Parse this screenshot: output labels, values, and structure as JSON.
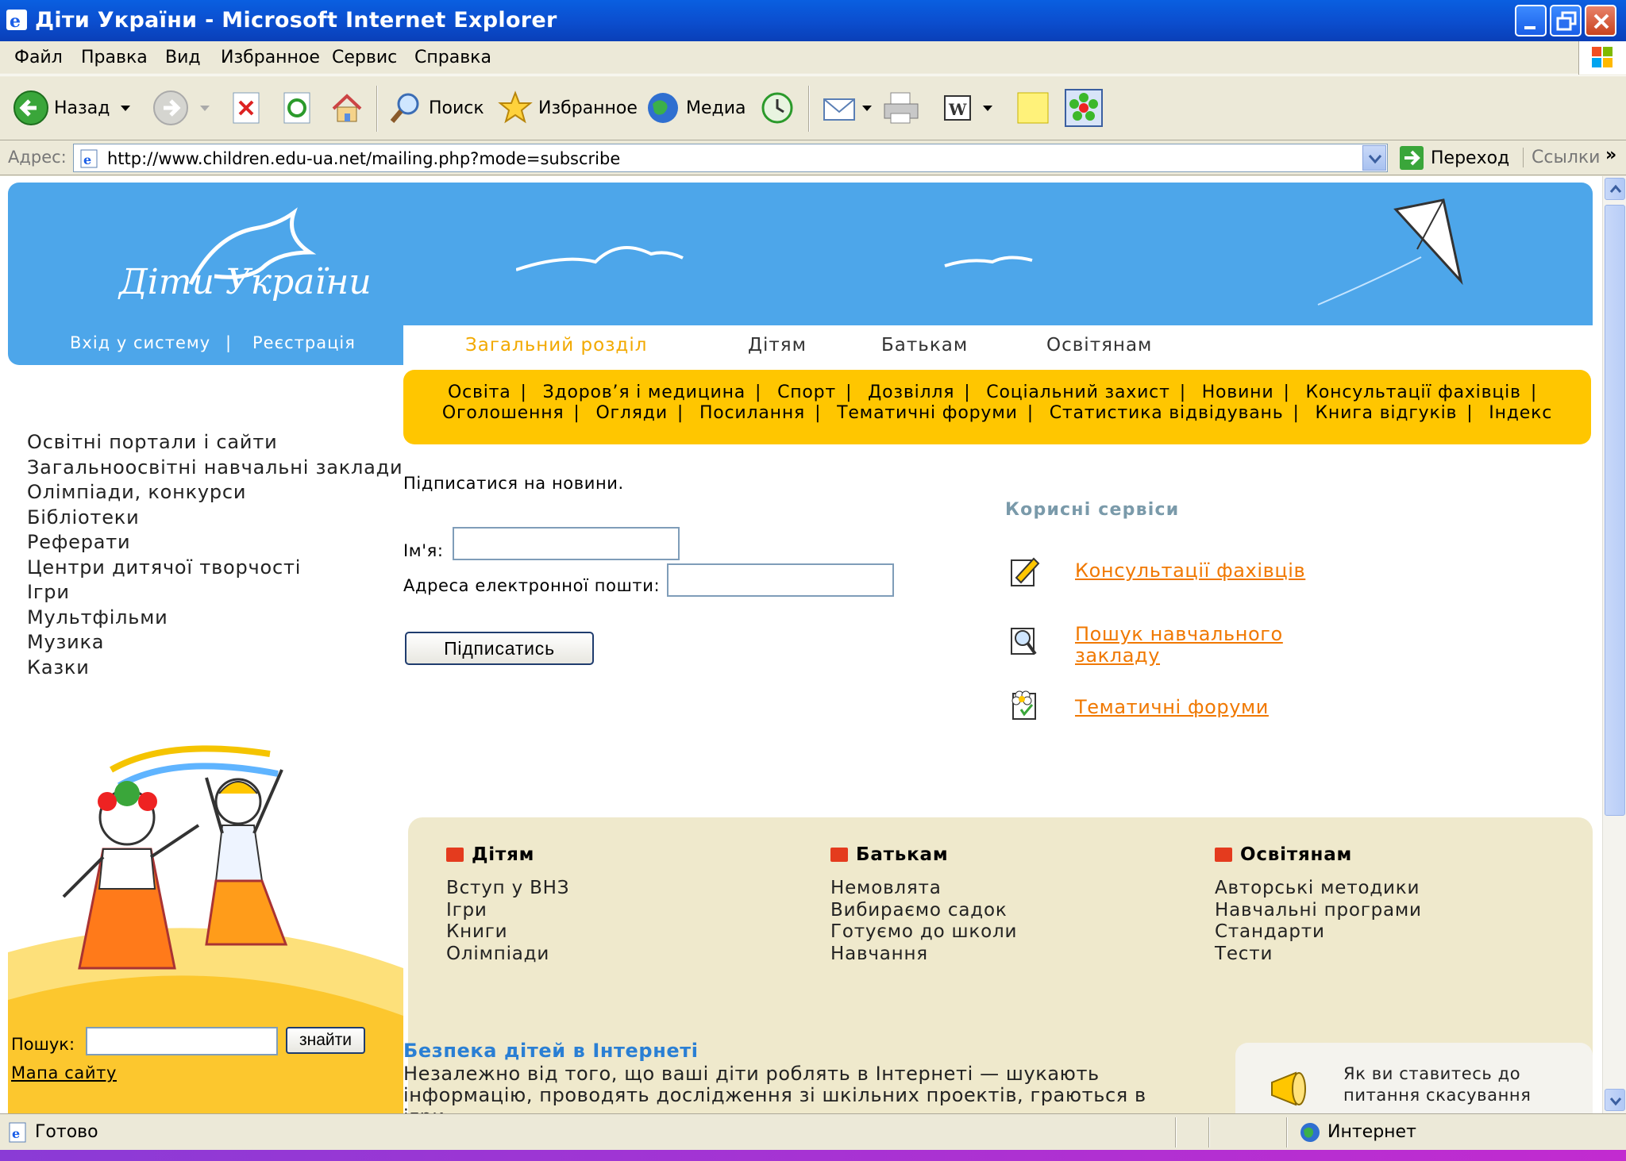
{
  "window": {
    "title": "Діти України - Microsoft Internet Explorer"
  },
  "menu": [
    "Файл",
    "Правка",
    "Вид",
    "Избранное",
    "Сервис",
    "Справка"
  ],
  "toolbar": {
    "back": "Назад",
    "search": "Поиск",
    "favorites": "Избранное",
    "media": "Медиа"
  },
  "address": {
    "label": "Адрес:",
    "url": "http://www.children.edu-ua.net/mailing.php?mode=subscribe",
    "go": "Переход",
    "links": "Ссылки"
  },
  "status": {
    "text": "Готово",
    "zone": "Интернет"
  },
  "site": {
    "logo": "Діти України",
    "login": "Вхід у систему",
    "login_sep": "|",
    "register": "Реєстрація",
    "tabs": [
      "Загальний розділ",
      "Дітям",
      "Батькам",
      "Освітянам"
    ],
    "nav_row1": [
      "Освіта",
      "Здоров’я і медицина",
      "Спорт",
      "Дозвілля",
      "Соціальний захист",
      "Новини",
      "Консультації фахівців"
    ],
    "nav_row2": [
      "Оголошення",
      "Огляди",
      "Посилання",
      "Тематичні форуми",
      "Статистика відвідувань",
      "Книга відгуків",
      "Індекс"
    ],
    "nav_sep": "|",
    "left_links": [
      "Освітні портали і сайти",
      "Загальноосвітні навчальні заклади",
      "Олімпіади, конкурси",
      "Бібліотеки",
      "Реферати",
      "Центри дитячої творчості",
      "Ігри",
      "Мультфільми",
      "Музика",
      "Казки"
    ],
    "search_label": "Пошук:",
    "search_button": "знайти",
    "sitemap": "Мапа сайту"
  },
  "subscribe": {
    "title": "Підписатися на новини.",
    "name_label": "Ім'я:",
    "email_label": "Адреса електронної пошти:",
    "button": "Підписатись"
  },
  "services": {
    "title": "Корисні сервіси",
    "items": [
      "Консультації фахівців",
      "Пошук навчального закладу",
      "Тематичні форуми"
    ]
  },
  "sections": [
    {
      "title": "Дітям",
      "items": [
        "Вступ у ВНЗ",
        "Ігри",
        "Книги",
        "Олімпіади"
      ]
    },
    {
      "title": "Батькам",
      "items": [
        "Немовлята",
        "Вибираємо садок",
        "Готуємо до школи",
        "Навчання"
      ]
    },
    {
      "title": "Освітянам",
      "items": [
        "Авторські методики",
        "Навчальні програми",
        "Стандарти",
        "Тести"
      ]
    }
  ],
  "safety": {
    "title": "Безпека дітей в Інтернеті",
    "text": "Незалежно від того, що ваші діти роблять в Інтернеті — шукають інформацію, проводять дослідження зі шкільних проектів, граються в ігри,"
  },
  "poll": {
    "text": "Як ви ставитесь до питання скасування"
  },
  "colors": {
    "sky": "#4da6ea",
    "nav_yellow": "#ffc600",
    "link_orange": "#f07800",
    "beige": "#efe9cc",
    "title_blue": "#2a7fd4"
  }
}
